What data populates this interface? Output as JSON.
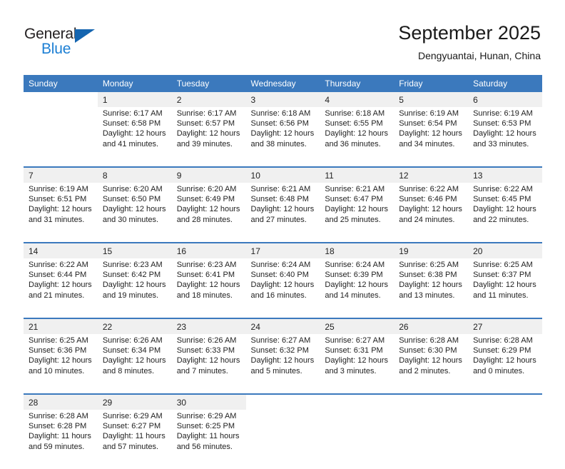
{
  "logo": {
    "word_one": "General",
    "word_two": "Blue",
    "triangle": "triangle-shape",
    "brand_dark": "#231f20",
    "brand_blue": "#1c7fd4",
    "triangle_blue": "#1565b0"
  },
  "header": {
    "title": "September 2025",
    "subtitle": "Dengyuantai, Hunan, China"
  },
  "theme": {
    "header_blue": "#3b79bd",
    "daynum_bg": "#f0f0f0",
    "text": "#222222",
    "cell_bg": "#ffffff"
  },
  "weekdays": [
    "Sunday",
    "Monday",
    "Tuesday",
    "Wednesday",
    "Thursday",
    "Friday",
    "Saturday"
  ],
  "weeks": [
    {
      "days": [
        {
          "num": "",
          "lines": []
        },
        {
          "num": "1",
          "lines": [
            "Sunrise: 6:17 AM",
            "Sunset: 6:58 PM",
            "Daylight: 12 hours",
            "and 41 minutes."
          ]
        },
        {
          "num": "2",
          "lines": [
            "Sunrise: 6:17 AM",
            "Sunset: 6:57 PM",
            "Daylight: 12 hours",
            "and 39 minutes."
          ]
        },
        {
          "num": "3",
          "lines": [
            "Sunrise: 6:18 AM",
            "Sunset: 6:56 PM",
            "Daylight: 12 hours",
            "and 38 minutes."
          ]
        },
        {
          "num": "4",
          "lines": [
            "Sunrise: 6:18 AM",
            "Sunset: 6:55 PM",
            "Daylight: 12 hours",
            "and 36 minutes."
          ]
        },
        {
          "num": "5",
          "lines": [
            "Sunrise: 6:19 AM",
            "Sunset: 6:54 PM",
            "Daylight: 12 hours",
            "and 34 minutes."
          ]
        },
        {
          "num": "6",
          "lines": [
            "Sunrise: 6:19 AM",
            "Sunset: 6:53 PM",
            "Daylight: 12 hours",
            "and 33 minutes."
          ]
        }
      ]
    },
    {
      "days": [
        {
          "num": "7",
          "lines": [
            "Sunrise: 6:19 AM",
            "Sunset: 6:51 PM",
            "Daylight: 12 hours",
            "and 31 minutes."
          ]
        },
        {
          "num": "8",
          "lines": [
            "Sunrise: 6:20 AM",
            "Sunset: 6:50 PM",
            "Daylight: 12 hours",
            "and 30 minutes."
          ]
        },
        {
          "num": "9",
          "lines": [
            "Sunrise: 6:20 AM",
            "Sunset: 6:49 PM",
            "Daylight: 12 hours",
            "and 28 minutes."
          ]
        },
        {
          "num": "10",
          "lines": [
            "Sunrise: 6:21 AM",
            "Sunset: 6:48 PM",
            "Daylight: 12 hours",
            "and 27 minutes."
          ]
        },
        {
          "num": "11",
          "lines": [
            "Sunrise: 6:21 AM",
            "Sunset: 6:47 PM",
            "Daylight: 12 hours",
            "and 25 minutes."
          ]
        },
        {
          "num": "12",
          "lines": [
            "Sunrise: 6:22 AM",
            "Sunset: 6:46 PM",
            "Daylight: 12 hours",
            "and 24 minutes."
          ]
        },
        {
          "num": "13",
          "lines": [
            "Sunrise: 6:22 AM",
            "Sunset: 6:45 PM",
            "Daylight: 12 hours",
            "and 22 minutes."
          ]
        }
      ]
    },
    {
      "days": [
        {
          "num": "14",
          "lines": [
            "Sunrise: 6:22 AM",
            "Sunset: 6:44 PM",
            "Daylight: 12 hours",
            "and 21 minutes."
          ]
        },
        {
          "num": "15",
          "lines": [
            "Sunrise: 6:23 AM",
            "Sunset: 6:42 PM",
            "Daylight: 12 hours",
            "and 19 minutes."
          ]
        },
        {
          "num": "16",
          "lines": [
            "Sunrise: 6:23 AM",
            "Sunset: 6:41 PM",
            "Daylight: 12 hours",
            "and 18 minutes."
          ]
        },
        {
          "num": "17",
          "lines": [
            "Sunrise: 6:24 AM",
            "Sunset: 6:40 PM",
            "Daylight: 12 hours",
            "and 16 minutes."
          ]
        },
        {
          "num": "18",
          "lines": [
            "Sunrise: 6:24 AM",
            "Sunset: 6:39 PM",
            "Daylight: 12 hours",
            "and 14 minutes."
          ]
        },
        {
          "num": "19",
          "lines": [
            "Sunrise: 6:25 AM",
            "Sunset: 6:38 PM",
            "Daylight: 12 hours",
            "and 13 minutes."
          ]
        },
        {
          "num": "20",
          "lines": [
            "Sunrise: 6:25 AM",
            "Sunset: 6:37 PM",
            "Daylight: 12 hours",
            "and 11 minutes."
          ]
        }
      ]
    },
    {
      "days": [
        {
          "num": "21",
          "lines": [
            "Sunrise: 6:25 AM",
            "Sunset: 6:36 PM",
            "Daylight: 12 hours",
            "and 10 minutes."
          ]
        },
        {
          "num": "22",
          "lines": [
            "Sunrise: 6:26 AM",
            "Sunset: 6:34 PM",
            "Daylight: 12 hours",
            "and 8 minutes."
          ]
        },
        {
          "num": "23",
          "lines": [
            "Sunrise: 6:26 AM",
            "Sunset: 6:33 PM",
            "Daylight: 12 hours",
            "and 7 minutes."
          ]
        },
        {
          "num": "24",
          "lines": [
            "Sunrise: 6:27 AM",
            "Sunset: 6:32 PM",
            "Daylight: 12 hours",
            "and 5 minutes."
          ]
        },
        {
          "num": "25",
          "lines": [
            "Sunrise: 6:27 AM",
            "Sunset: 6:31 PM",
            "Daylight: 12 hours",
            "and 3 minutes."
          ]
        },
        {
          "num": "26",
          "lines": [
            "Sunrise: 6:28 AM",
            "Sunset: 6:30 PM",
            "Daylight: 12 hours",
            "and 2 minutes."
          ]
        },
        {
          "num": "27",
          "lines": [
            "Sunrise: 6:28 AM",
            "Sunset: 6:29 PM",
            "Daylight: 12 hours",
            "and 0 minutes."
          ]
        }
      ]
    },
    {
      "days": [
        {
          "num": "28",
          "lines": [
            "Sunrise: 6:28 AM",
            "Sunset: 6:28 PM",
            "Daylight: 11 hours",
            "and 59 minutes."
          ]
        },
        {
          "num": "29",
          "lines": [
            "Sunrise: 6:29 AM",
            "Sunset: 6:27 PM",
            "Daylight: 11 hours",
            "and 57 minutes."
          ]
        },
        {
          "num": "30",
          "lines": [
            "Sunrise: 6:29 AM",
            "Sunset: 6:25 PM",
            "Daylight: 11 hours",
            "and 56 minutes."
          ]
        },
        {
          "num": "",
          "lines": []
        },
        {
          "num": "",
          "lines": []
        },
        {
          "num": "",
          "lines": []
        },
        {
          "num": "",
          "lines": []
        }
      ]
    }
  ]
}
